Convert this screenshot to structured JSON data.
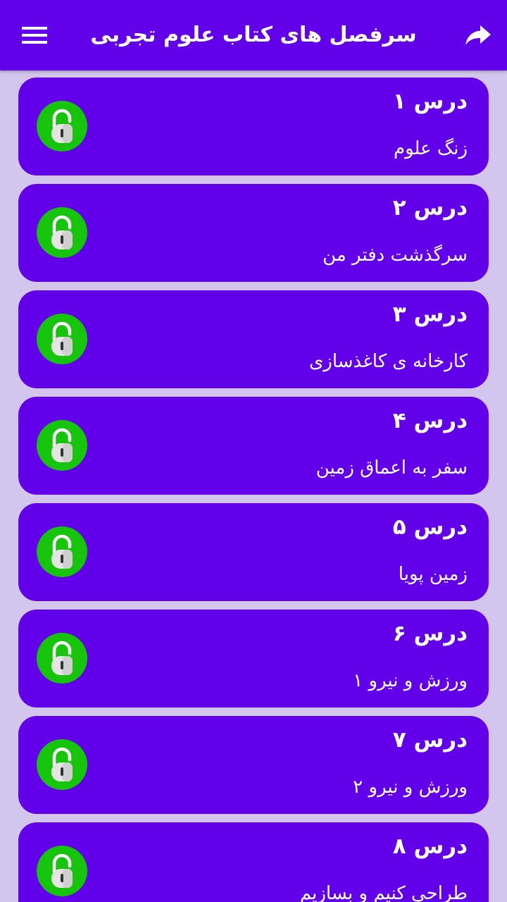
{
  "app_bar": {
    "title": "سرفصل های کتاب علوم تجربی",
    "menu_icon": "hamburger-menu-icon",
    "share_icon": "share-arrow-icon"
  },
  "colors": {
    "primary": "#6200ea",
    "background": "#d3c6ec",
    "lock_green": "#16c40c",
    "lock_body": "#e5e5e5"
  },
  "lessons": [
    {
      "number": "درس ۱",
      "title": "زنگ علوم"
    },
    {
      "number": "درس ۲",
      "title": "سرگذشت دفتر من"
    },
    {
      "number": "درس ۳",
      "title": "کارخانه ی کاغذسازی"
    },
    {
      "number": "درس ۴",
      "title": "سفر به اعماق زمین"
    },
    {
      "number": "درس ۵",
      "title": "زمین پویا"
    },
    {
      "number": "درس ۶",
      "title": "ورزش و نیرو ۱"
    },
    {
      "number": "درس ۷",
      "title": "ورزش و نیرو ۲"
    },
    {
      "number": "درس ۸",
      "title": "طراحی کنیم و بسازیم"
    }
  ]
}
